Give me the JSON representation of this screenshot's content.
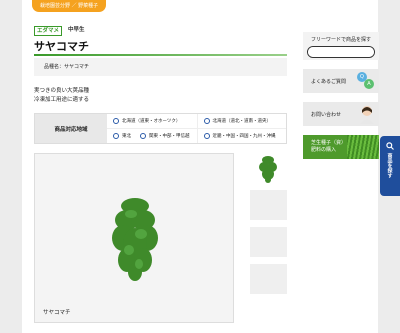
{
  "breadcrumb": {
    "text": "栽培園芸分野 ／ 野菜種子"
  },
  "product": {
    "tag_brand": "エダマメ",
    "tag_type": "中早生",
    "title": "サヤコマチ",
    "name_label": "品種名：サヤコマチ",
    "desc_line1": "実つきの良い大莢品種",
    "desc_line2": "冷凍加工用途に適する",
    "image_caption": "サヤコマチ"
  },
  "region": {
    "label": "商品対応地域",
    "options": [
      "北海道（道東・オホーツク）",
      "北海道（道北・道南・道央）",
      "東北",
      "関東・中部・甲信越",
      "近畿・中国・四国・九州・沖縄"
    ]
  },
  "sidebar": {
    "freeword_label": "フリーワードで商品を探す",
    "freeword_placeholder": "",
    "search_button": "検索",
    "faq_label": "よくあるご質問",
    "contact_label": "お問い合わせ",
    "purchase_line1": "芝生種子（資）",
    "purchase_line2": "肥料の購入"
  },
  "floating": {
    "label": "商品を探す"
  },
  "colors": {
    "accent": "#f5a21f",
    "green": "#3a9a2a",
    "blue": "#1f4e9c"
  }
}
